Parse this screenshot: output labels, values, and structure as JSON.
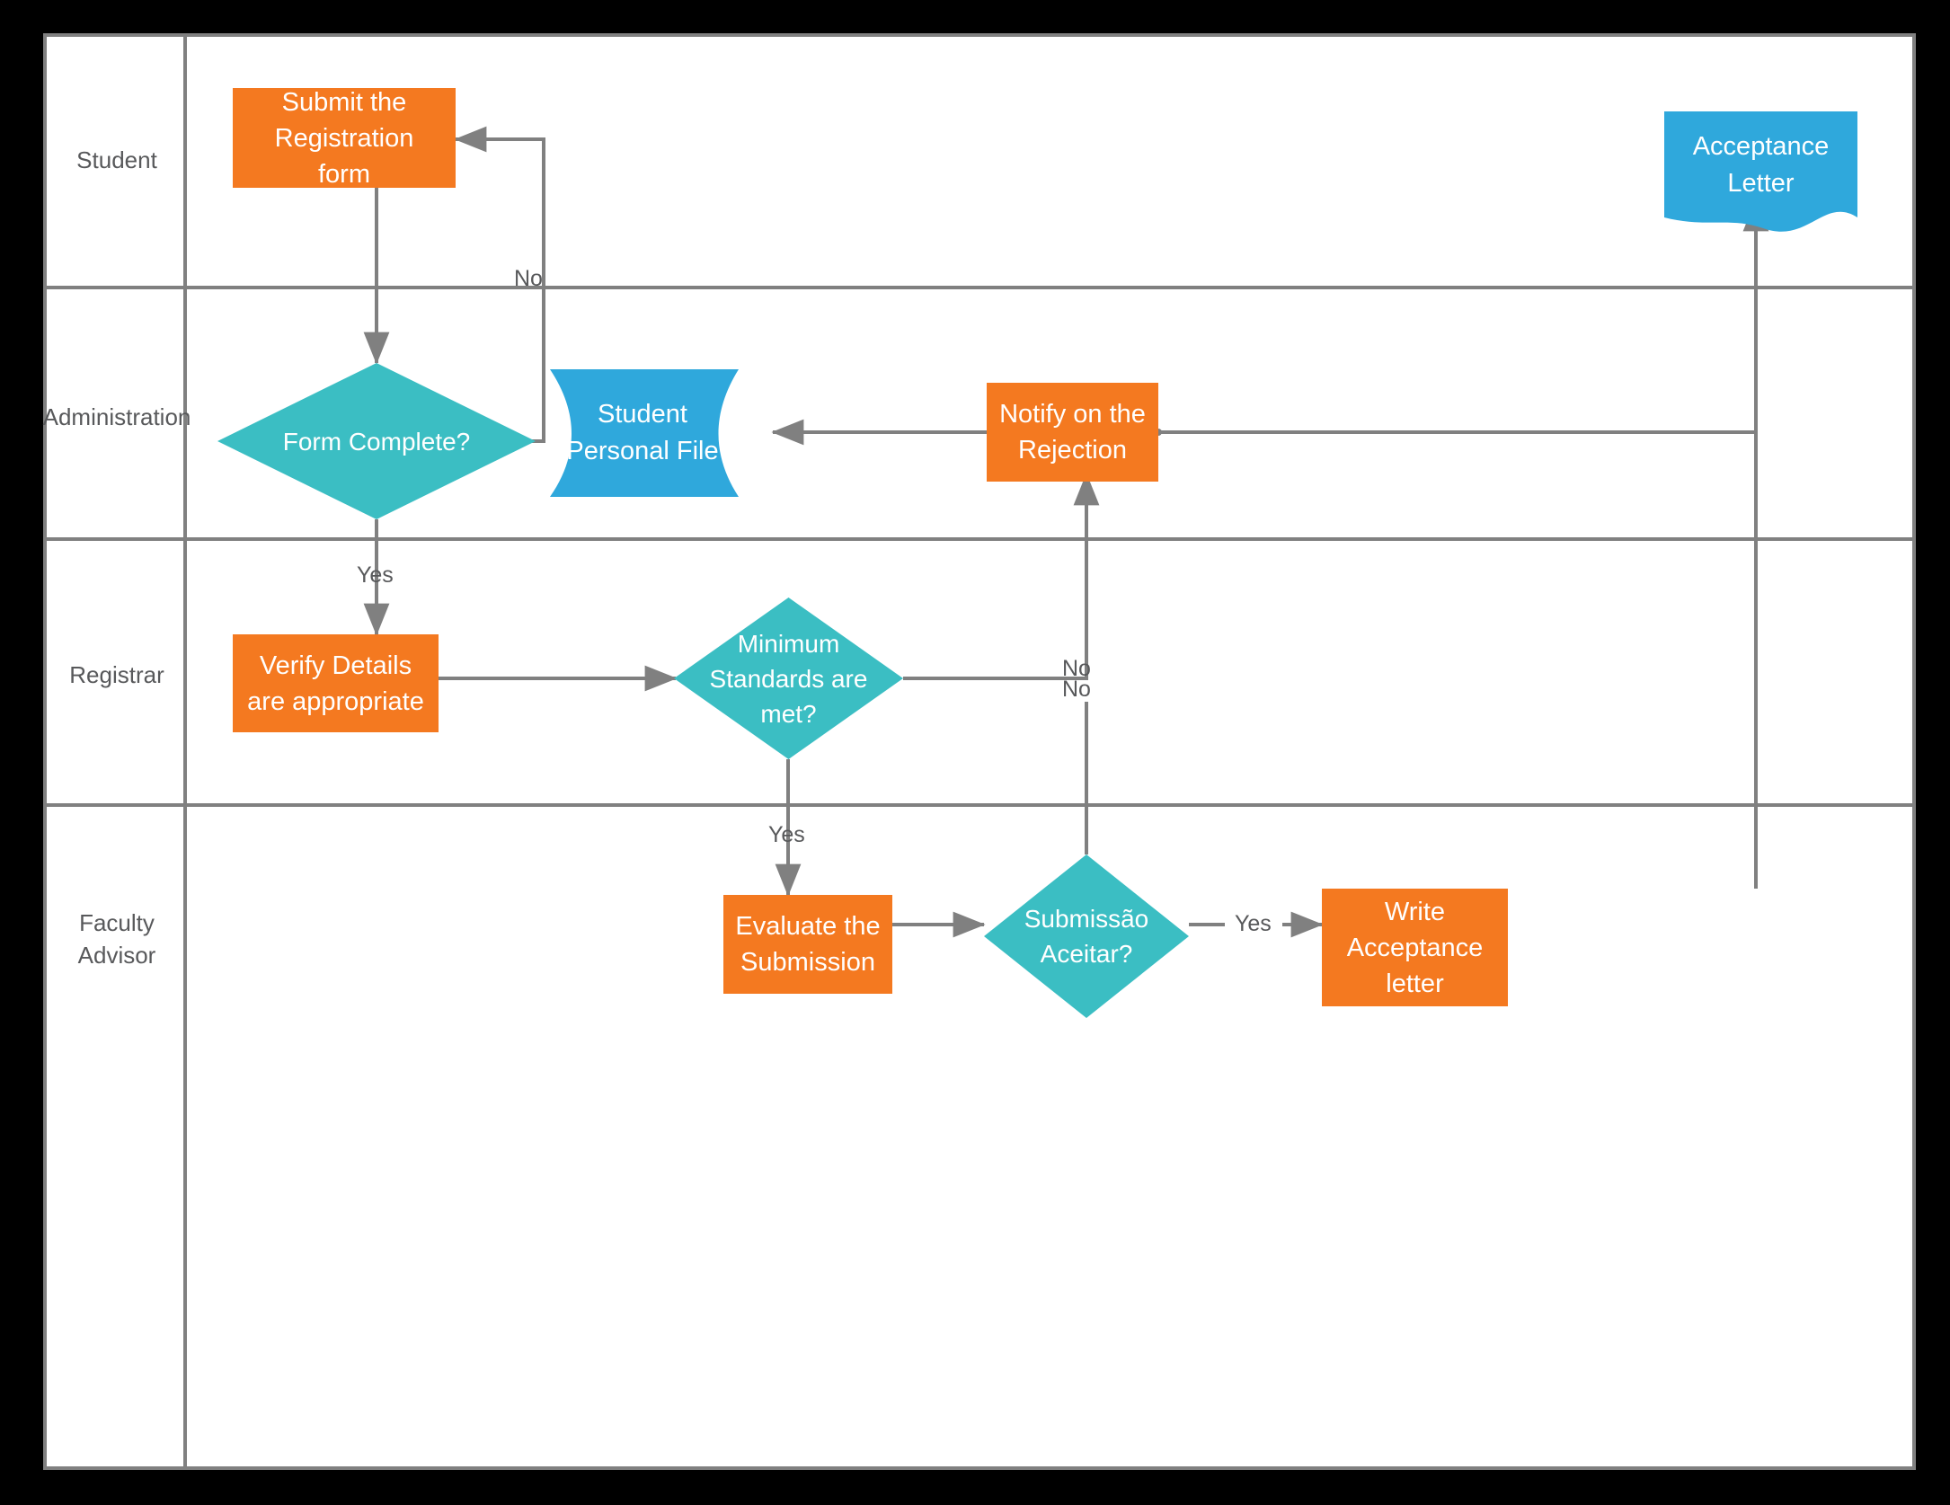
{
  "diagram": {
    "type": "swimlane-flowchart",
    "colors": {
      "process": "#f47920",
      "decision": "#3bbec3",
      "document": "#2fa8dc",
      "connector": "#808080",
      "lane_border": "#808080",
      "lane_label_text": "#58595b",
      "background": "#000000",
      "canvas": "#ffffff"
    },
    "lanes": [
      {
        "id": "student",
        "label": "Student"
      },
      {
        "id": "administration",
        "label": "Administration"
      },
      {
        "id": "registrar",
        "label": "Registrar"
      },
      {
        "id": "faculty-advisor",
        "label": "Faculty\nAdvisor",
        "label_line1": "Faculty",
        "label_line2": "Advisor"
      }
    ],
    "nodes": [
      {
        "id": "submit-registration-form",
        "lane": "student",
        "shape": "process",
        "label": "Submit the Registration form"
      },
      {
        "id": "acceptance-letter",
        "lane": "student",
        "shape": "document",
        "label": "Acceptance Letter"
      },
      {
        "id": "form-complete",
        "lane": "administration",
        "shape": "decision",
        "label": "Form Complete?"
      },
      {
        "id": "student-personal-file",
        "lane": "administration",
        "shape": "data",
        "label": "Student Personal File"
      },
      {
        "id": "notify-on-the-rejection",
        "lane": "administration",
        "shape": "process",
        "label": "Notify on the Rejection"
      },
      {
        "id": "verify-details-are-appropriate",
        "lane": "registrar",
        "shape": "process",
        "label": "Verify Details are appropriate"
      },
      {
        "id": "minimum-standards-are-met",
        "lane": "registrar",
        "shape": "decision",
        "label": "Minimum Standards are met?"
      },
      {
        "id": "evaluate-the-submission",
        "lane": "faculty-advisor",
        "shape": "process",
        "label": "Evaluate the Submission"
      },
      {
        "id": "submissao-aceitar",
        "lane": "faculty-advisor",
        "shape": "decision",
        "label": "Submissão Aceitar?"
      },
      {
        "id": "write-acceptance-letter",
        "lane": "faculty-advisor",
        "shape": "process",
        "label": "Write Acceptance letter"
      }
    ],
    "edge_labels": {
      "form_complete_no": "No",
      "form_complete_yes": "Yes",
      "minimum_standards_no_upper": "No",
      "minimum_standards_no_lower": "No",
      "minimum_standards_yes": "Yes",
      "submissao_aceitar_yes": "Yes"
    },
    "edges": [
      {
        "from": "submit-registration-form",
        "to": "form-complete",
        "label": ""
      },
      {
        "from": "form-complete",
        "to": "submit-registration-form",
        "label": "No"
      },
      {
        "from": "form-complete",
        "to": "verify-details-are-appropriate",
        "label": "Yes"
      },
      {
        "from": "verify-details-are-appropriate",
        "to": "minimum-standards-are-met",
        "label": ""
      },
      {
        "from": "minimum-standards-are-met",
        "to": "notify-on-the-rejection",
        "label": "No"
      },
      {
        "from": "minimum-standards-are-met",
        "to": "evaluate-the-submission",
        "label": "Yes"
      },
      {
        "from": "evaluate-the-submission",
        "to": "submissao-aceitar",
        "label": ""
      },
      {
        "from": "submissao-aceitar",
        "to": "notify-on-the-rejection",
        "label": "No"
      },
      {
        "from": "submissao-aceitar",
        "to": "write-acceptance-letter",
        "label": "Yes"
      },
      {
        "from": "notify-on-the-rejection",
        "to": "student-personal-file",
        "label": ""
      },
      {
        "from": "write-acceptance-letter",
        "to": "acceptance-letter",
        "label": ""
      }
    ]
  }
}
